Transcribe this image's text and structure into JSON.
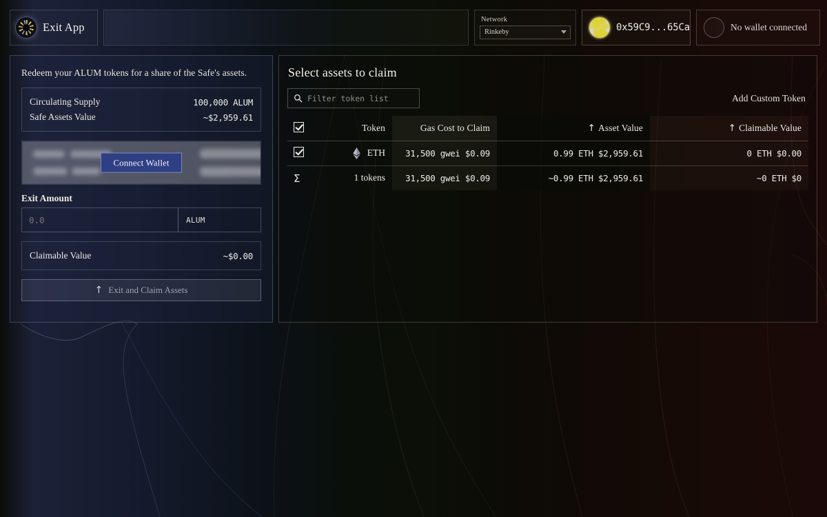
{
  "header": {
    "brand_title": "Exit App",
    "brand_logo_icon": "circular-exit-logo-icon",
    "network_label": "Network",
    "network_value": "Rinkeby",
    "network_chevron_icon": "chevron-down-icon",
    "address": "0x59C9...65Ca",
    "address_avatar_icon": "blockie-avatar-icon",
    "wallet_status": "No wallet connected",
    "wallet_avatar_icon": "empty-avatar-icon"
  },
  "left": {
    "intro": "Redeem your ALUM tokens for a share of the Safe's assets.",
    "stats": [
      {
        "label": "Circulating Supply",
        "value": "100,000 ALUM"
      },
      {
        "label": "Safe Assets Value",
        "value": "~$2,959.61"
      }
    ],
    "connect_button": "Connect Wallet",
    "exit_amount_label": "Exit Amount",
    "amount_value": "0.0",
    "amount_placeholder": "0.0",
    "amount_unit": "ALUM",
    "claimable_label": "Claimable Value",
    "claimable_value": "~$0.00",
    "exit_button": "Exit and Claim Assets",
    "exit_button_icon": "up-arrow-icon"
  },
  "right": {
    "title": "Select assets to claim",
    "search_placeholder": "Filter token list",
    "search_value": "",
    "search_icon": "search-icon",
    "add_custom_token": "Add Custom Token",
    "table": {
      "select_all_checked": true,
      "headers": {
        "checkbox": "",
        "token": "Token",
        "gas": "Gas Cost to Claim",
        "asset": "Asset Value",
        "claimable": "Claimable Value",
        "asset_sort_icon": "sort-ascending-arrow-icon",
        "claimable_sort_icon": "sort-ascending-arrow-icon"
      },
      "rows": [
        {
          "checked": true,
          "token": "ETH",
          "token_icon": "ethereum-icon",
          "gas": "31,500 gwei $0.09",
          "asset": "0.99 ETH $2,959.61",
          "claimable": "0 ETH $0.00"
        }
      ],
      "summary": {
        "symbol": "Σ",
        "token": "1 tokens",
        "gas": "31,500 gwei $0.09",
        "asset": "~0.99 ETH $2,959.61",
        "claimable": "~0 ETH $0"
      }
    }
  },
  "theme": {
    "bg_left": "#1d2238",
    "bg_mid": "#0a0c08",
    "bg_right": "#1a0908",
    "accent_blue": "#2e3f84",
    "text_primary": "#f0ede6",
    "text_muted": "#9ea2b3"
  }
}
